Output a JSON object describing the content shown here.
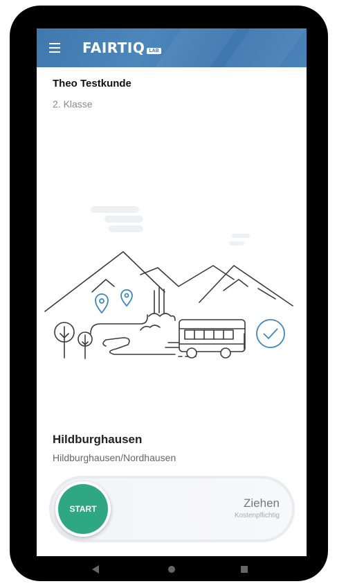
{
  "app": {
    "logo_text": "FAIRTIQ",
    "logo_badge": "LAB"
  },
  "user": {
    "name": "Theo Testkunde",
    "class": "2. Klasse"
  },
  "station": {
    "name": "Hildburghausen",
    "zone": "Hildburghausen/Nordhausen"
  },
  "slider": {
    "start_label": "START",
    "action_label": "Ziehen",
    "action_sublabel": "Kostenpflichtig"
  },
  "colors": {
    "appbar": "#3f78ad",
    "start_button": "#2fa783",
    "illustration_accent": "#3d86bf"
  },
  "icons": {
    "menu": "hamburger-menu-icon",
    "back": "nav-back-icon",
    "home": "nav-home-icon",
    "recent": "nav-recent-apps-icon"
  }
}
